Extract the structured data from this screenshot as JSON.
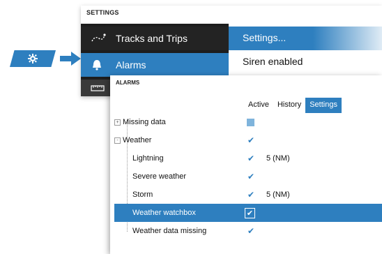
{
  "settings": {
    "title": "SETTINGS",
    "menu": [
      {
        "label": "Tracks and Trips",
        "icon": "tracks-icon"
      },
      {
        "label": "Alarms",
        "icon": "bell-icon"
      },
      {
        "label": "",
        "icon": "ruler-icon"
      }
    ],
    "submenu": [
      {
        "label": "Settings..."
      },
      {
        "label": "Siren enabled"
      }
    ]
  },
  "alarms": {
    "title": "ALARMS",
    "tabs": [
      "Active",
      "History",
      "Settings"
    ],
    "rows": [
      {
        "name": "Missing data",
        "expander": "+",
        "state": "partial",
        "value": ""
      },
      {
        "name": "Weather",
        "expander": "-",
        "state": "checked",
        "value": ""
      },
      {
        "name": "Lightning",
        "state": "checked",
        "value": "5 (NM)"
      },
      {
        "name": "Severe weather",
        "state": "checked",
        "value": ""
      },
      {
        "name": "Storm",
        "state": "checked",
        "value": "5 (NM)"
      },
      {
        "name": "Weather watchbox",
        "state": "checked",
        "value": "",
        "selected": true
      },
      {
        "name": "Weather data missing",
        "state": "checked",
        "value": ""
      }
    ]
  },
  "colors": {
    "accent": "#2e7fbf",
    "dark": "#1d1d1d"
  }
}
